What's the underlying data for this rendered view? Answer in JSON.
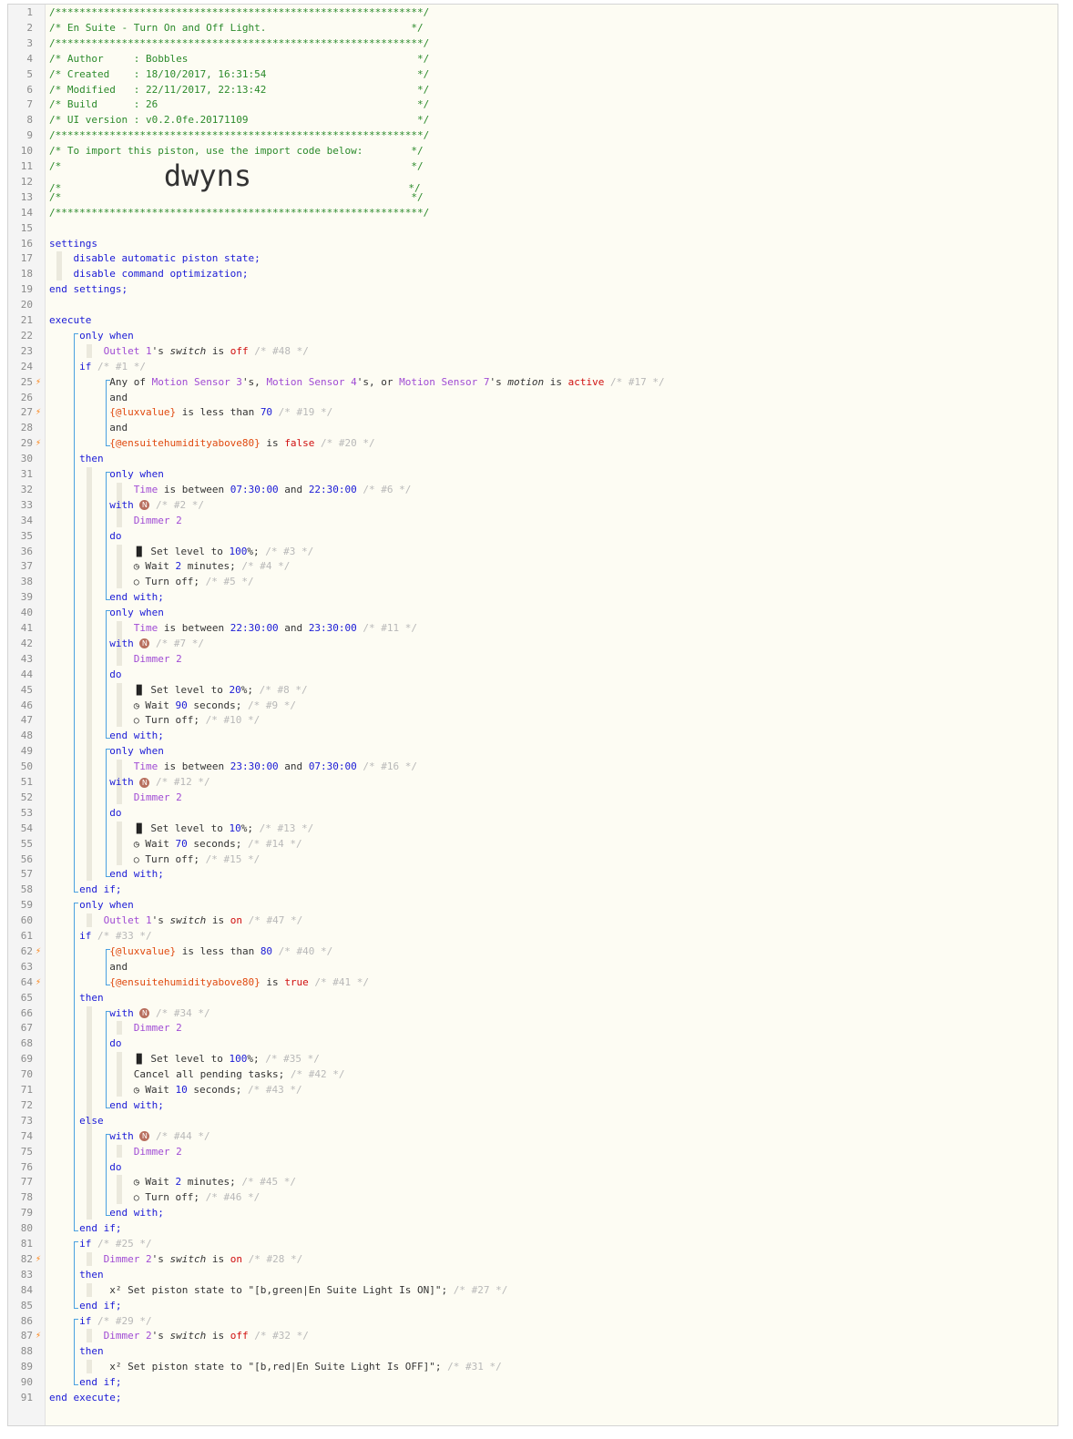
{
  "lines": [
    {
      "n": 1,
      "segs": [
        [
          "c-com",
          "/*************************************************************/"
        ]
      ]
    },
    {
      "n": 2,
      "segs": [
        [
          "c-com",
          "/* En Suite - Turn On and Off Light.                        */"
        ]
      ]
    },
    {
      "n": 3,
      "segs": [
        [
          "c-com",
          "/*************************************************************/"
        ]
      ]
    },
    {
      "n": 4,
      "segs": [
        [
          "c-com",
          "/* Author     : Bobbles                                      */"
        ]
      ]
    },
    {
      "n": 5,
      "segs": [
        [
          "c-com",
          "/* Created    : 18/10/2017, 16:31:54                         */"
        ]
      ]
    },
    {
      "n": 6,
      "segs": [
        [
          "c-com",
          "/* Modified   : 22/11/2017, 22:13:42                         */"
        ]
      ]
    },
    {
      "n": 7,
      "segs": [
        [
          "c-com",
          "/* Build      : 26                                           */"
        ]
      ]
    },
    {
      "n": 8,
      "segs": [
        [
          "c-com",
          "/* UI version : v0.2.0fe.20171109                            */"
        ]
      ]
    },
    {
      "n": 9,
      "segs": [
        [
          "c-com",
          "/*************************************************************/"
        ]
      ]
    },
    {
      "n": 10,
      "segs": [
        [
          "c-com",
          "/* To import this piston, use the import code below:        */"
        ]
      ]
    },
    {
      "n": 11,
      "segs": [
        [
          "c-com",
          "/*                                                          */"
        ]
      ]
    },
    {
      "n": 12,
      "segs": [
        [
          "c-com",
          "/*                 "
        ],
        [
          "big",
          "dwyns"
        ],
        [
          "c-com",
          "                          */"
        ]
      ]
    },
    {
      "n": 13,
      "segs": [
        [
          "c-com",
          "/*                                                          */"
        ]
      ]
    },
    {
      "n": 14,
      "segs": [
        [
          "c-com",
          "/*************************************************************/"
        ]
      ]
    },
    {
      "n": 15,
      "segs": []
    },
    {
      "n": 16,
      "segs": [
        [
          "c-kw",
          "settings"
        ]
      ]
    },
    {
      "n": 17,
      "segs": [
        [
          "c-kw",
          "    disable automatic piston state;"
        ]
      ]
    },
    {
      "n": 18,
      "segs": [
        [
          "c-kw",
          "    disable command optimization;"
        ]
      ]
    },
    {
      "n": 19,
      "segs": [
        [
          "c-kw",
          "end settings;"
        ]
      ]
    },
    {
      "n": 20,
      "segs": []
    },
    {
      "n": 21,
      "segs": [
        [
          "c-kw",
          "execute"
        ]
      ]
    },
    {
      "n": 22,
      "segs": [
        [
          "c-kw",
          "     only when"
        ]
      ]
    },
    {
      "n": 23,
      "segs": [
        [
          "",
          "         "
        ],
        [
          "c-dev",
          "Outlet 1"
        ],
        [
          "",
          "'s "
        ],
        [
          "c-attr",
          "switch"
        ],
        [
          "",
          " is "
        ],
        [
          "c-red",
          "off"
        ],
        [
          "c-id",
          " /* #48 */"
        ]
      ]
    },
    {
      "n": 24,
      "segs": [
        [
          "c-kw",
          "     if"
        ],
        [
          "c-id",
          " /* #1 */"
        ]
      ]
    },
    {
      "n": 25,
      "bolt": true,
      "segs": [
        [
          "",
          "          Any of "
        ],
        [
          "c-dev",
          "Motion Sensor 3"
        ],
        [
          "",
          "'s, "
        ],
        [
          "c-dev",
          "Motion Sensor 4"
        ],
        [
          "",
          "'s, or "
        ],
        [
          "c-dev",
          "Motion Sensor 7"
        ],
        [
          "",
          "'s "
        ],
        [
          "c-attr",
          "motion"
        ],
        [
          "",
          " is "
        ],
        [
          "c-red",
          "active"
        ],
        [
          "c-id",
          " /* #17 */"
        ]
      ]
    },
    {
      "n": 26,
      "segs": [
        [
          "",
          "          and"
        ]
      ]
    },
    {
      "n": 27,
      "bolt": true,
      "segs": [
        [
          "",
          "          "
        ],
        [
          "c-var",
          "{@luxvalue}"
        ],
        [
          "",
          " is less than "
        ],
        [
          "c-num",
          "70"
        ],
        [
          "c-id",
          " /* #19 */"
        ]
      ]
    },
    {
      "n": 28,
      "segs": [
        [
          "",
          "          and"
        ]
      ]
    },
    {
      "n": 29,
      "bolt": true,
      "segs": [
        [
          "",
          "          "
        ],
        [
          "c-var",
          "{@ensuitehumidityabove80}"
        ],
        [
          "",
          " is "
        ],
        [
          "c-red",
          "false"
        ],
        [
          "c-id",
          " /* #20 */"
        ]
      ]
    },
    {
      "n": 30,
      "segs": [
        [
          "c-kw",
          "     then"
        ]
      ]
    },
    {
      "n": 31,
      "segs": [
        [
          "c-kw",
          "          only when"
        ]
      ]
    },
    {
      "n": 32,
      "segs": [
        [
          "",
          "              "
        ],
        [
          "c-dev",
          "Time"
        ],
        [
          "",
          " is between "
        ],
        [
          "c-num",
          "07:30:00"
        ],
        [
          "",
          " and "
        ],
        [
          "c-num",
          "22:30:00"
        ],
        [
          "c-id",
          " /* #6 */"
        ]
      ]
    },
    {
      "n": 33,
      "segs": [
        [
          "c-kw",
          "          with "
        ],
        [
          "nb",
          "N"
        ],
        [
          "c-id",
          " /* #2 */"
        ]
      ]
    },
    {
      "n": 34,
      "segs": [
        [
          "",
          "              "
        ],
        [
          "c-dev",
          "Dimmer 2"
        ]
      ]
    },
    {
      "n": 35,
      "segs": [
        [
          "c-kw",
          "          do"
        ]
      ]
    },
    {
      "n": 36,
      "segs": [
        [
          "",
          "              "
        ],
        [
          "ico",
          "▐▌"
        ],
        [
          "",
          " Set level to "
        ],
        [
          "c-num",
          "100"
        ],
        [
          "",
          "%; "
        ],
        [
          "c-id",
          "/* #3 */"
        ]
      ]
    },
    {
      "n": 37,
      "segs": [
        [
          "",
          "              "
        ],
        [
          "ico",
          "◷"
        ],
        [
          "",
          " Wait "
        ],
        [
          "c-num",
          "2"
        ],
        [
          "",
          " minutes; "
        ],
        [
          "c-id",
          "/* #4 */"
        ]
      ]
    },
    {
      "n": 38,
      "segs": [
        [
          "",
          "              "
        ],
        [
          "ico",
          "○"
        ],
        [
          "",
          " Turn off; "
        ],
        [
          "c-id",
          "/* #5 */"
        ]
      ]
    },
    {
      "n": 39,
      "segs": [
        [
          "c-kw",
          "          end with;"
        ]
      ]
    },
    {
      "n": 40,
      "segs": [
        [
          "c-kw",
          "          only when"
        ]
      ]
    },
    {
      "n": 41,
      "segs": [
        [
          "",
          "              "
        ],
        [
          "c-dev",
          "Time"
        ],
        [
          "",
          " is between "
        ],
        [
          "c-num",
          "22:30:00"
        ],
        [
          "",
          " and "
        ],
        [
          "c-num",
          "23:30:00"
        ],
        [
          "c-id",
          " /* #11 */"
        ]
      ]
    },
    {
      "n": 42,
      "segs": [
        [
          "c-kw",
          "          with "
        ],
        [
          "nb",
          "N"
        ],
        [
          "c-id",
          " /* #7 */"
        ]
      ]
    },
    {
      "n": 43,
      "segs": [
        [
          "",
          "              "
        ],
        [
          "c-dev",
          "Dimmer 2"
        ]
      ]
    },
    {
      "n": 44,
      "segs": [
        [
          "c-kw",
          "          do"
        ]
      ]
    },
    {
      "n": 45,
      "segs": [
        [
          "",
          "              "
        ],
        [
          "ico",
          "▐▌"
        ],
        [
          "",
          " Set level to "
        ],
        [
          "c-num",
          "20"
        ],
        [
          "",
          "%; "
        ],
        [
          "c-id",
          "/* #8 */"
        ]
      ]
    },
    {
      "n": 46,
      "segs": [
        [
          "",
          "              "
        ],
        [
          "ico",
          "◷"
        ],
        [
          "",
          " Wait "
        ],
        [
          "c-num",
          "90"
        ],
        [
          "",
          " seconds; "
        ],
        [
          "c-id",
          "/* #9 */"
        ]
      ]
    },
    {
      "n": 47,
      "segs": [
        [
          "",
          "              "
        ],
        [
          "ico",
          "○"
        ],
        [
          "",
          " Turn off; "
        ],
        [
          "c-id",
          "/* #10 */"
        ]
      ]
    },
    {
      "n": 48,
      "segs": [
        [
          "c-kw",
          "          end with;"
        ]
      ]
    },
    {
      "n": 49,
      "segs": [
        [
          "c-kw",
          "          only when"
        ]
      ]
    },
    {
      "n": 50,
      "segs": [
        [
          "",
          "              "
        ],
        [
          "c-dev",
          "Time"
        ],
        [
          "",
          " is between "
        ],
        [
          "c-num",
          "23:30:00"
        ],
        [
          "",
          " and "
        ],
        [
          "c-num",
          "07:30:00"
        ],
        [
          "c-id",
          " /* #16 */"
        ]
      ]
    },
    {
      "n": 51,
      "segs": [
        [
          "c-kw",
          "          with "
        ],
        [
          "nb",
          "N"
        ],
        [
          "c-id",
          " /* #12 */"
        ]
      ]
    },
    {
      "n": 52,
      "segs": [
        [
          "",
          "              "
        ],
        [
          "c-dev",
          "Dimmer 2"
        ]
      ]
    },
    {
      "n": 53,
      "segs": [
        [
          "c-kw",
          "          do"
        ]
      ]
    },
    {
      "n": 54,
      "segs": [
        [
          "",
          "              "
        ],
        [
          "ico",
          "▐▌"
        ],
        [
          "",
          " Set level to "
        ],
        [
          "c-num",
          "10"
        ],
        [
          "",
          "%; "
        ],
        [
          "c-id",
          "/* #13 */"
        ]
      ]
    },
    {
      "n": 55,
      "segs": [
        [
          "",
          "              "
        ],
        [
          "ico",
          "◷"
        ],
        [
          "",
          " Wait "
        ],
        [
          "c-num",
          "70"
        ],
        [
          "",
          " seconds; "
        ],
        [
          "c-id",
          "/* #14 */"
        ]
      ]
    },
    {
      "n": 56,
      "segs": [
        [
          "",
          "              "
        ],
        [
          "ico",
          "○"
        ],
        [
          "",
          " Turn off; "
        ],
        [
          "c-id",
          "/* #15 */"
        ]
      ]
    },
    {
      "n": 57,
      "segs": [
        [
          "c-kw",
          "          end with;"
        ]
      ]
    },
    {
      "n": 58,
      "segs": [
        [
          "c-kw",
          "     end if;"
        ]
      ]
    },
    {
      "n": 59,
      "segs": [
        [
          "c-kw",
          "     only when"
        ]
      ]
    },
    {
      "n": 60,
      "segs": [
        [
          "",
          "         "
        ],
        [
          "c-dev",
          "Outlet 1"
        ],
        [
          "",
          "'s "
        ],
        [
          "c-attr",
          "switch"
        ],
        [
          "",
          " is "
        ],
        [
          "c-red",
          "on"
        ],
        [
          "c-id",
          " /* #47 */"
        ]
      ]
    },
    {
      "n": 61,
      "segs": [
        [
          "c-kw",
          "     if"
        ],
        [
          "c-id",
          " /* #33 */"
        ]
      ]
    },
    {
      "n": 62,
      "bolt": true,
      "segs": [
        [
          "",
          "          "
        ],
        [
          "c-var",
          "{@luxvalue}"
        ],
        [
          "",
          " is less than "
        ],
        [
          "c-num",
          "80"
        ],
        [
          "c-id",
          " /* #40 */"
        ]
      ]
    },
    {
      "n": 63,
      "segs": [
        [
          "",
          "          and"
        ]
      ]
    },
    {
      "n": 64,
      "bolt": true,
      "segs": [
        [
          "",
          "          "
        ],
        [
          "c-var",
          "{@ensuitehumidityabove80}"
        ],
        [
          "",
          " is "
        ],
        [
          "c-red",
          "true"
        ],
        [
          "c-id",
          " /* #41 */"
        ]
      ]
    },
    {
      "n": 65,
      "segs": [
        [
          "c-kw",
          "     then"
        ]
      ]
    },
    {
      "n": 66,
      "segs": [
        [
          "c-kw",
          "          with "
        ],
        [
          "nb",
          "N"
        ],
        [
          "c-id",
          " /* #34 */"
        ]
      ]
    },
    {
      "n": 67,
      "segs": [
        [
          "",
          "              "
        ],
        [
          "c-dev",
          "Dimmer 2"
        ]
      ]
    },
    {
      "n": 68,
      "segs": [
        [
          "c-kw",
          "          do"
        ]
      ]
    },
    {
      "n": 69,
      "segs": [
        [
          "",
          "              "
        ],
        [
          "ico",
          "▐▌"
        ],
        [
          "",
          " Set level to "
        ],
        [
          "c-num",
          "100"
        ],
        [
          "",
          "%; "
        ],
        [
          "c-id",
          "/* #35 */"
        ]
      ]
    },
    {
      "n": 70,
      "segs": [
        [
          "",
          "              Cancel all pending tasks; "
        ],
        [
          "c-id",
          "/* #42 */"
        ]
      ]
    },
    {
      "n": 71,
      "segs": [
        [
          "",
          "              "
        ],
        [
          "ico",
          "◷"
        ],
        [
          "",
          " Wait "
        ],
        [
          "c-num",
          "10"
        ],
        [
          "",
          " seconds; "
        ],
        [
          "c-id",
          "/* #43 */"
        ]
      ]
    },
    {
      "n": 72,
      "segs": [
        [
          "c-kw",
          "          end with;"
        ]
      ]
    },
    {
      "n": 73,
      "segs": [
        [
          "c-kw",
          "     else"
        ]
      ]
    },
    {
      "n": 74,
      "segs": [
        [
          "c-kw",
          "          with "
        ],
        [
          "nb",
          "N"
        ],
        [
          "c-id",
          " /* #44 */"
        ]
      ]
    },
    {
      "n": 75,
      "segs": [
        [
          "",
          "              "
        ],
        [
          "c-dev",
          "Dimmer 2"
        ]
      ]
    },
    {
      "n": 76,
      "segs": [
        [
          "c-kw",
          "          do"
        ]
      ]
    },
    {
      "n": 77,
      "segs": [
        [
          "",
          "              "
        ],
        [
          "ico",
          "◷"
        ],
        [
          "",
          " Wait "
        ],
        [
          "c-num",
          "2"
        ],
        [
          "",
          " minutes; "
        ],
        [
          "c-id",
          "/* #45 */"
        ]
      ]
    },
    {
      "n": 78,
      "segs": [
        [
          "",
          "              "
        ],
        [
          "ico",
          "○"
        ],
        [
          "",
          " Turn off; "
        ],
        [
          "c-id",
          "/* #46 */"
        ]
      ]
    },
    {
      "n": 79,
      "segs": [
        [
          "c-kw",
          "          end with;"
        ]
      ]
    },
    {
      "n": 80,
      "segs": [
        [
          "c-kw",
          "     end if;"
        ]
      ]
    },
    {
      "n": 81,
      "segs": [
        [
          "c-kw",
          "     if"
        ],
        [
          "c-id",
          " /* #25 */"
        ]
      ]
    },
    {
      "n": 82,
      "bolt": true,
      "segs": [
        [
          "",
          "         "
        ],
        [
          "c-dev",
          "Dimmer 2"
        ],
        [
          "",
          "'s "
        ],
        [
          "c-attr",
          "switch"
        ],
        [
          "",
          " is "
        ],
        [
          "c-red",
          "on"
        ],
        [
          "c-id",
          " /* #28 */"
        ]
      ]
    },
    {
      "n": 83,
      "segs": [
        [
          "c-kw",
          "     then"
        ]
      ]
    },
    {
      "n": 84,
      "segs": [
        [
          "",
          "          x² Set piston state to \"[b,green|En Suite Light Is ON]\"; "
        ],
        [
          "c-id",
          "/* #27 */"
        ]
      ]
    },
    {
      "n": 85,
      "segs": [
        [
          "c-kw",
          "     end if;"
        ]
      ]
    },
    {
      "n": 86,
      "segs": [
        [
          "c-kw",
          "     if"
        ],
        [
          "c-id",
          " /* #29 */"
        ]
      ]
    },
    {
      "n": 87,
      "bolt": true,
      "segs": [
        [
          "",
          "         "
        ],
        [
          "c-dev",
          "Dimmer 2"
        ],
        [
          "",
          "'s "
        ],
        [
          "c-attr",
          "switch"
        ],
        [
          "",
          " is "
        ],
        [
          "c-red",
          "off"
        ],
        [
          "c-id",
          " /* #32 */"
        ]
      ]
    },
    {
      "n": 88,
      "segs": [
        [
          "c-kw",
          "     then"
        ]
      ]
    },
    {
      "n": 89,
      "segs": [
        [
          "",
          "          x² Set piston state to \"[b,red|En Suite Light Is OFF]\"; "
        ],
        [
          "c-id",
          "/* #31 */"
        ]
      ]
    },
    {
      "n": 90,
      "segs": [
        [
          "c-kw",
          "     end if;"
        ]
      ]
    },
    {
      "n": 91,
      "segs": [
        [
          "c-kw",
          "end execute;"
        ]
      ]
    }
  ]
}
